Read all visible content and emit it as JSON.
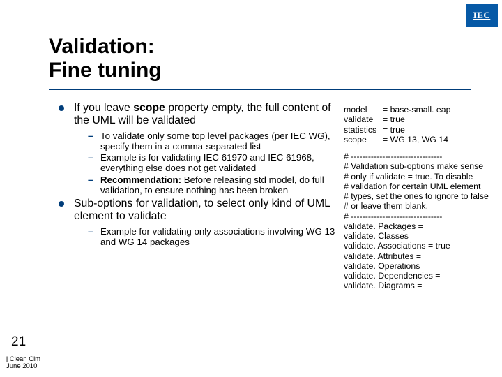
{
  "logo": {
    "text": "IEC"
  },
  "title": {
    "line1": "Validation:",
    "line2": "Fine tuning"
  },
  "bullets": {
    "b1": {
      "pre": "If you leave ",
      "strong": "scope",
      "post": " property empty, the full content of the UML will be validated"
    },
    "b1_sub": [
      "To validate only some top level packages (per IEC WG), specify them in a comma-separated list",
      "Example is for validating IEC 61970 and IEC 61968, everything else does not get validated"
    ],
    "b1_rec": {
      "strong": "Recommendation:",
      "post": " Before releasing std model, do full validation, to ensure nothing has been broken"
    },
    "b2": "Sub-options for validation, to select only kind of UML element to validate",
    "b2_sub": [
      "Example for validating only associations involving WG 13 and WG 14 packages"
    ]
  },
  "config": {
    "kv": [
      {
        "k": "model",
        "v": "= base-small. eap"
      },
      {
        "k": "validate",
        "v": "= true"
      },
      {
        "k": "statistics",
        "v": "= true"
      },
      {
        "k": "scope",
        "v": "= WG 13, WG 14"
      }
    ],
    "lines": [
      "# --------------------------------",
      "# Validation sub-options make sense",
      "# only if validate = true. To disable",
      "# validation for certain UML element",
      "# types, set the ones to ignore to false",
      "# or leave them blank.",
      "# --------------------------------",
      "validate. Packages =",
      "validate. Classes =",
      "validate. Associations = true",
      "validate. Attributes =",
      "validate. Operations =",
      "validate. Dependencies =",
      "validate. Diagrams ="
    ]
  },
  "slidenum": "21",
  "footer": {
    "l1": "j Clean Cim",
    "l2": "June 2010"
  }
}
